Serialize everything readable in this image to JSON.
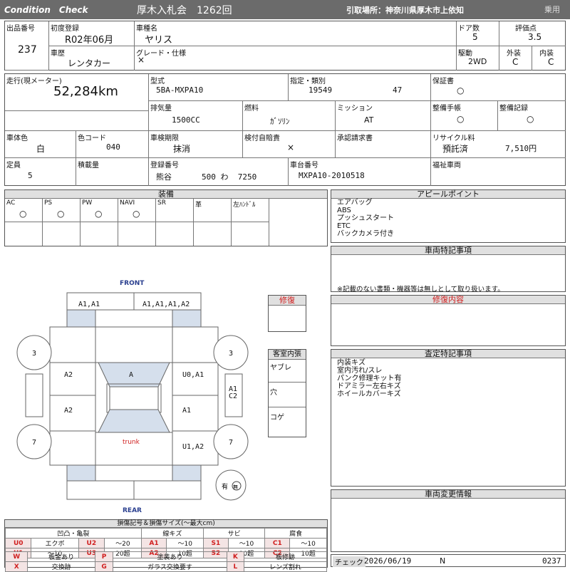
{
  "header": {
    "condition_check": "Condition　Check",
    "auction": "厚木入札会　1262回",
    "pickup": "引取場所：神奈川県厚木市上依知",
    "usage": "乗用"
  },
  "basic": {
    "lot_label": "出品番号",
    "lot": "237",
    "first_reg_label": "初度登録",
    "first_reg": "R02年06月",
    "model_name_label": "車種名",
    "model_name": "ヤリス",
    "doors_label": "ドア数",
    "doors": "5",
    "score_label": "評価点",
    "score": "3.5",
    "history_label": "車歴",
    "history": "レンタカー",
    "grade_label": "グレード・仕様",
    "grade": "×",
    "drive_label": "駆動",
    "drive": "2WD",
    "exterior_label": "外装",
    "exterior": "C",
    "interior_label": "内装",
    "interior": "C"
  },
  "spec": {
    "mileage_label": "走行(現メーター)",
    "mileage": "52,284km",
    "type_label": "型式",
    "type": "5BA-MXPA10",
    "designation_label": "指定・類別",
    "designation": "19549",
    "classification": "47",
    "displacement_label": "排気量",
    "displacement": "1500CC",
    "fuel_label": "燃料",
    "fuel": "ｶﾞｿﾘﾝ",
    "transmission_label": "ミッション",
    "transmission": "AT",
    "warranty_label": "保証書",
    "warranty": "○",
    "manual_label": "整備手帳",
    "manual": "○",
    "maint_label": "整備記録",
    "maint": "○",
    "color_label": "車体色",
    "color": "白",
    "color_code_label": "色コード",
    "color_code": "040",
    "inspection_label": "車検期限",
    "inspection": "抹消",
    "autotax_label": "検付自賠責",
    "autotax": "×",
    "approval_label": "承認請求書",
    "capacity_label": "定員",
    "capacity": "5",
    "load_label": "積載量",
    "plate_label": "登録番号",
    "plate_area": "熊谷",
    "plate_num": "500 わ  7250",
    "chassis_label": "車台番号",
    "chassis": "MXPA10-2010518",
    "recycle_label": "リサイクル料",
    "recycle_status": "預託済",
    "recycle_fee": "7,510円",
    "welfare_label": "福祉車両"
  },
  "equipment": {
    "title": "装備",
    "items": [
      {
        "label": "AC",
        "value": "○"
      },
      {
        "label": "PS",
        "value": "○"
      },
      {
        "label": "PW",
        "value": "○"
      },
      {
        "label": "NAVI",
        "value": "○"
      },
      {
        "label": "SR",
        "value": ""
      },
      {
        "label": "革",
        "value": ""
      },
      {
        "label": "左ﾊﾝﾄﾞﾙ",
        "value": ""
      }
    ]
  },
  "appeal": {
    "title": "アピールポイント",
    "lines": [
      "エアバッグ",
      "ABS",
      "プッシュスタート",
      "ETC",
      "バックカメラ付き"
    ]
  },
  "special": {
    "title": "車両特記事項",
    "note": "※記載のない書類・機器等は無しとして取り扱います。"
  },
  "repair_detail": {
    "title": "修復内容"
  },
  "assessment": {
    "title": "査定特記事項",
    "lines": [
      "内装キズ",
      "室内汚れ/スレ",
      "パンク修理キット有",
      "ドアミラー左右キズ",
      "ホイールカバーキズ"
    ]
  },
  "change": {
    "title": "車両変更情報"
  },
  "check": {
    "label": "チェック",
    "date": "2026/06/19",
    "mark": "N",
    "lot": "0237"
  },
  "diagram": {
    "front": "FRONT",
    "rear": "REAR",
    "trunk": "trunk",
    "front_left": "A1,A1",
    "front_right": "A1,A1,A1,A2",
    "tire": "3",
    "tire_rear": "7",
    "left_front_door": "A2",
    "left_rear_door": "A2",
    "roof_front": "A",
    "right_front_door": "U0,A1",
    "right_rear_door": "A1",
    "right_pillar": "A1\nC2",
    "right_rear": "U1,A2",
    "spare": "有",
    "spare_mark": "無"
  },
  "side": {
    "repair": "修復",
    "interior": "客室内張",
    "yabure": "ヤブレ",
    "ana": "穴",
    "koge": "コゲ"
  },
  "legend": {
    "title": "損傷記号＆損傷サイズ(〜最大cm)",
    "groups": [
      "凹凸・亀裂",
      "線キズ",
      "サビ",
      "腐食"
    ],
    "rows": [
      [
        "U0",
        "エクボ",
        "U2",
        "〜20",
        "A1",
        "〜10",
        "S1",
        "〜10",
        "C1",
        "〜10"
      ],
      [
        "U1",
        "〜10",
        "U3",
        "20超",
        "A2",
        "10超",
        "S2",
        "10超",
        "C2",
        "10超"
      ]
    ],
    "marks": [
      [
        "W",
        "板金あり",
        "P",
        "塗装あり",
        "K",
        "板修跡"
      ],
      [
        "X",
        "交換跡",
        "G",
        "ガラス交換要す",
        "L",
        "レンズ割れ"
      ]
    ]
  }
}
